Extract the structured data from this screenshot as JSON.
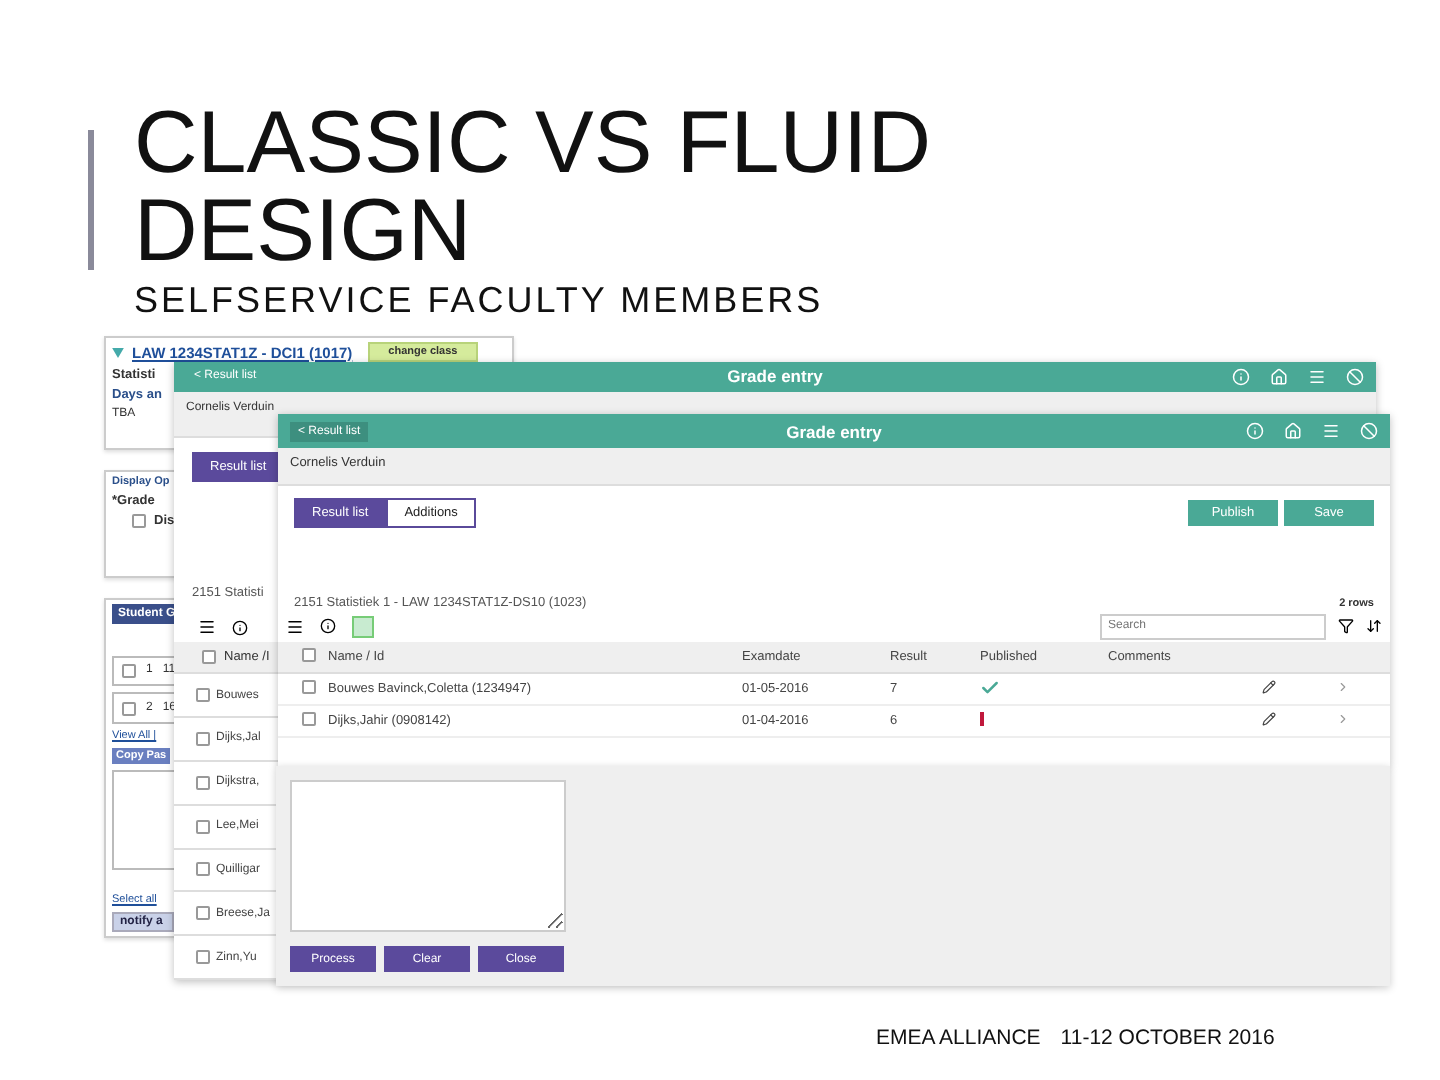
{
  "slide": {
    "title_lines": [
      "CLASSIC VS FLUID",
      "DESIGN"
    ],
    "subtitle": "SELFSERVICE FACULTY MEMBERS",
    "footer": [
      "EMEA ALLIANCE",
      "11-12 OCTOBER 2016"
    ]
  },
  "classic": {
    "class_link": "LAW 1234STAT1Z - DCI1 (1017)",
    "change_button": "change class",
    "labels": [
      "Statisti",
      "Days an"
    ],
    "days_value": "TBA",
    "display_heading": "Display Op",
    "grade_label": "*Grade",
    "option": {
      "label": "Dis",
      "checked": false
    },
    "grid_heading": "Student G",
    "grid_rows": [
      {
        "number": "1",
        "cell": "11",
        "checked": false
      },
      {
        "number": "2",
        "cell": "16",
        "checked": false
      }
    ],
    "view_all": "View All |",
    "copy_heading": "Copy Pas",
    "select_all": "Select all",
    "notify_button": "notify a"
  },
  "fluid_back": {
    "back_button": "< Result list",
    "title": "Grade entry",
    "person": "Cornelis Verduin",
    "tab": {
      "label": "Result list",
      "selected": true
    },
    "course": "2151 Statisti",
    "name_header": "Name /I",
    "all_checked": false,
    "names": [
      {
        "name": "Bouwes",
        "checked": false
      },
      {
        "name": "Dijks,Jal",
        "checked": false
      },
      {
        "name": "Dijkstra,",
        "checked": false
      },
      {
        "name": "Lee,Mei",
        "checked": false
      },
      {
        "name": "Quilligar",
        "checked": false
      },
      {
        "name": "Breese,Ja",
        "checked": false
      },
      {
        "name": "Zinn,Yu",
        "checked": false
      }
    ]
  },
  "fluid_front": {
    "back_button": "< Result list",
    "title": "Grade entry",
    "person": "Cornelis Verduin",
    "tabs": [
      {
        "label": "Result list",
        "selected": true
      },
      {
        "label": "Additions",
        "selected": false
      }
    ],
    "actions": [
      "Publish",
      "Save"
    ],
    "course": "2151 Statistiek 1 - LAW 1234STAT1Z-DS10 (1023)",
    "row_count": "2 rows",
    "search": {
      "placeholder": "Search"
    },
    "all_checked": false,
    "columns": [
      "Name / Id",
      "Examdate",
      "Result",
      "Published",
      "Comments"
    ],
    "rows": [
      {
        "name": "Bouwes Bavinck,Coletta (1234947)",
        "examdate": "01-05-2016",
        "result": "7",
        "published": true,
        "checked": false
      },
      {
        "name": "Dijks,Jahir (0908142)",
        "examdate": "01-04-2016",
        "result": "6",
        "published": false,
        "checked": false
      }
    ]
  },
  "dialog": {
    "buttons": [
      "Process",
      "Clear",
      "Close"
    ]
  }
}
